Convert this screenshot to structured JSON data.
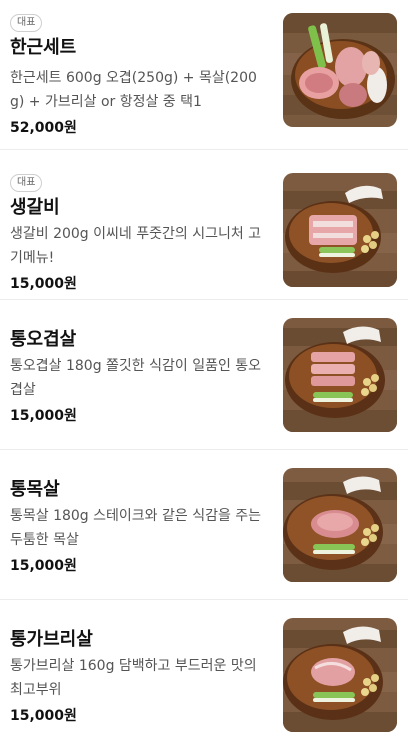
{
  "menu_items": [
    {
      "badge": "대표",
      "name": "한근세트",
      "description": "한근세트 600g 오겹(250g) + 목살(200g) + 가브리살 or 항정살 중 택1",
      "price": "52,000원",
      "image_icon": "pork-set-platter-icon"
    },
    {
      "badge": "대표",
      "name": "생갈비",
      "description": "생갈비 200g 이씨네 푸줏간의 시그니처 고기메뉴!",
      "price": "15,000원",
      "image_icon": "pork-rib-platter-icon"
    },
    {
      "badge": "",
      "name": "통오겹살",
      "description": "통오겹살 180g 쫄깃한 식감이 일품인 통오겹살",
      "price": "15,000원",
      "image_icon": "pork-belly-platter-icon"
    },
    {
      "badge": "",
      "name": "통목살",
      "description": "통목살 180g 스테이크와 같은 식감을 주는 두툼한 목살",
      "price": "15,000원",
      "image_icon": "pork-neck-platter-icon"
    },
    {
      "badge": "",
      "name": "통가브리살",
      "description": "통가브리살 160g 담백하고 부드러운 맛의 최고부위",
      "price": "15,000원",
      "image_icon": "pork-jowl-platter-icon"
    }
  ]
}
